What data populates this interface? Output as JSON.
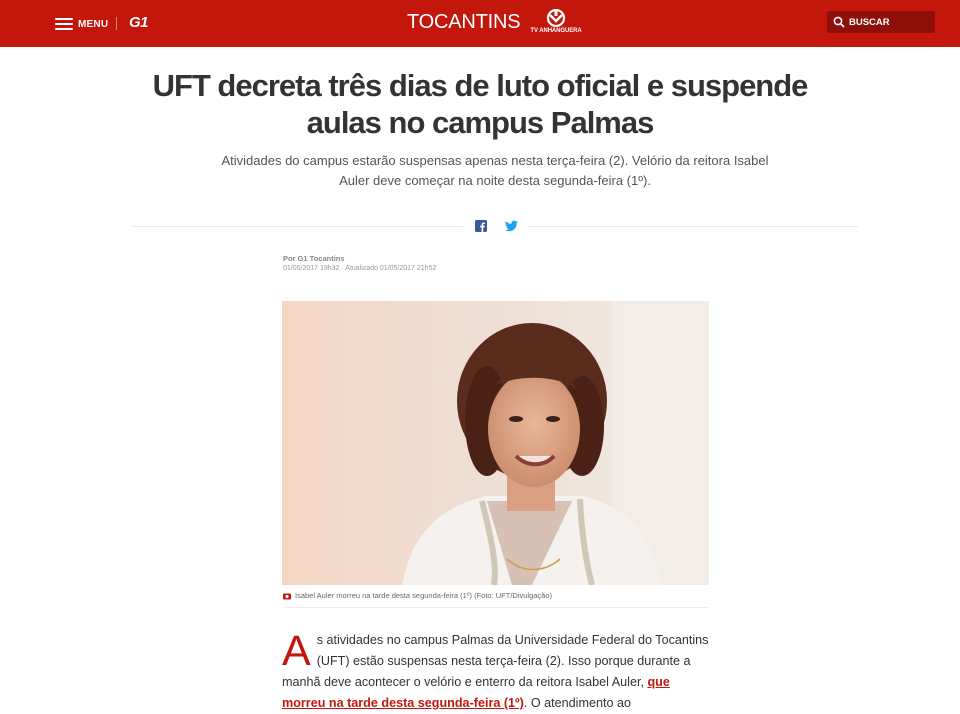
{
  "header": {
    "menu_label": "MENU",
    "g1_logo": "G1",
    "region": "TOCANTINS",
    "affiliate_name": "TV ANHANGUERA",
    "search_label": "BUSCAR",
    "brand_color": "#c4170c"
  },
  "article": {
    "title": "UFT decreta três dias de luto oficial e suspende aulas no campus Palmas",
    "subtitle": "Atividades do campus estarão suspensas apenas nesta terça-feira (2). Velório da reitora Isabel Auler deve começar na noite desta segunda-feira (1º).",
    "share": {
      "facebook_icon": "facebook-icon",
      "twitter_icon": "twitter-icon"
    },
    "byline": "Por G1 Tocantins",
    "dates": "01/05/2017 19h32 · Atualizado 01/05/2017 21h52",
    "photo_caption": "Isabel Auler morreu na tarde desta segunda-feira (1º) (Foto: UFT/Divulgação)",
    "body": {
      "dropcap": "A",
      "text_part1": "s atividades no campus Palmas da Universidade Federal do Tocantins (UFT) estão suspensas nesta terça-feira (2). Isso porque durante a manhã deve acontecer o velório e enterro da reitora Isabel Auler, ",
      "link_text": "que morreu na tarde desta segunda-feira (1º)",
      "text_part2": ". O atendimento ao"
    }
  }
}
